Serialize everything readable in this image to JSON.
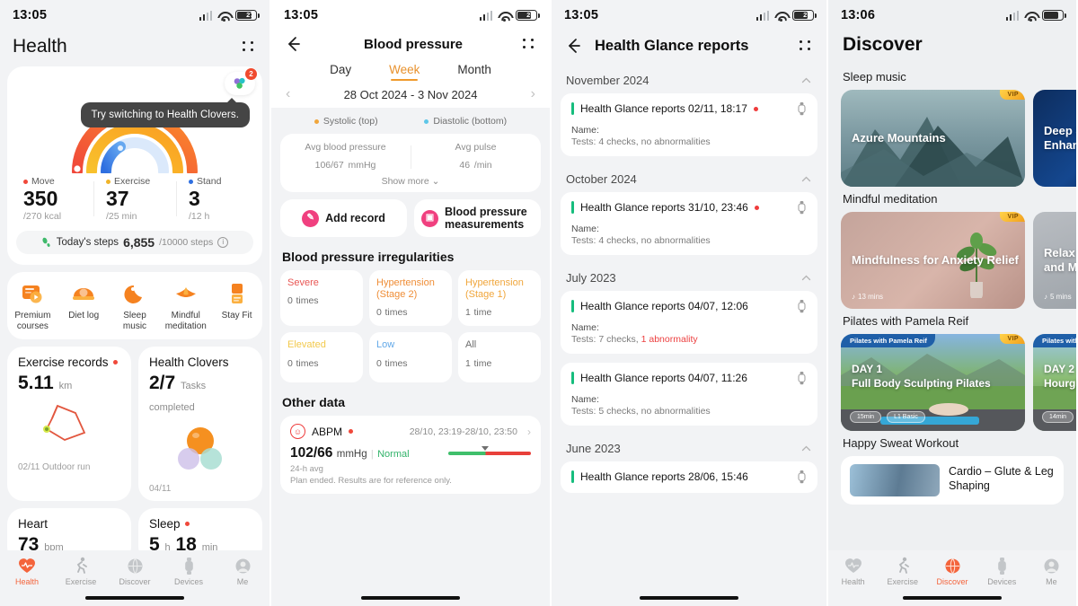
{
  "panel1": {
    "status": {
      "time": "13:05",
      "battery": "27"
    },
    "header": {
      "title": "Health",
      "menu_icon": "kebab-menu-icon"
    },
    "clover_badge": "2",
    "tooltip": "Try switching to Health Clovers.",
    "rings": [
      {
        "label": "Move",
        "value": "350",
        "sub": "/270 kcal",
        "color": "#f0483a"
      },
      {
        "label": "Exercise",
        "value": "37",
        "sub": "/25 min",
        "color": "#f0b429"
      },
      {
        "label": "Stand",
        "value": "3",
        "sub": "/12 h",
        "color": "#2f6fe0"
      }
    ],
    "steps": {
      "label": "Today's steps",
      "value": "6,855",
      "goal": "/10000 steps",
      "info": "i"
    },
    "quick_actions": [
      {
        "label": "Premium courses",
        "icon": "premium-courses-icon"
      },
      {
        "label": "Diet log",
        "icon": "diet-log-icon"
      },
      {
        "label": "Sleep music",
        "icon": "sleep-music-icon"
      },
      {
        "label": "Mindful meditation",
        "icon": "mindful-meditation-icon"
      },
      {
        "label": "Stay Fit",
        "icon": "stay-fit-icon"
      }
    ],
    "exercise_card": {
      "title": "Exercise records",
      "value": "5.11",
      "unit": "km",
      "footer": "02/11 Outdoor run"
    },
    "clovers_card": {
      "title": "Health Clovers",
      "value": "2/7",
      "unit": "Tasks completed",
      "footer": "04/11"
    },
    "heart_card": {
      "title": "Heart",
      "value": "73",
      "unit": "bpm"
    },
    "sleep_card": {
      "title": "Sleep",
      "hours": "5",
      "h_unit": "h",
      "minutes": "18",
      "m_unit": "min"
    },
    "tabs": [
      {
        "label": "Health",
        "icon": "heart-icon",
        "active": true
      },
      {
        "label": "Exercise",
        "icon": "runner-icon",
        "active": false
      },
      {
        "label": "Discover",
        "icon": "globe-icon",
        "active": false
      },
      {
        "label": "Devices",
        "icon": "watch-icon",
        "active": false
      },
      {
        "label": "Me",
        "icon": "person-icon",
        "active": false
      }
    ]
  },
  "panel2": {
    "status": {
      "time": "13:05",
      "battery": "25"
    },
    "header": {
      "title": "Blood pressure",
      "back_icon": "back-arrow-icon",
      "menu_icon": "kebab-menu-icon"
    },
    "segments": [
      {
        "label": "Day",
        "active": false
      },
      {
        "label": "Week",
        "active": true
      },
      {
        "label": "Month",
        "active": false
      }
    ],
    "date_range": "28 Oct 2024 - 3 Nov 2024",
    "legend": [
      {
        "label": "Systolic (top)",
        "color": "#f0a63c"
      },
      {
        "label": "Diastolic (bottom)",
        "color": "#5ec6e8"
      }
    ],
    "avg": {
      "bp_label": "Avg blood pressure",
      "bp_value": "106/67",
      "bp_unit": "mmHg",
      "pulse_label": "Avg pulse",
      "pulse_value": "46",
      "pulse_unit": "/min",
      "show_more": "Show more"
    },
    "actions": [
      {
        "label": "Add record",
        "icon": "add-record-icon"
      },
      {
        "label": "Blood pressure measurements",
        "icon": "bp-measure-icon"
      }
    ],
    "irregularities_title": "Blood pressure irregularities",
    "irregularities": [
      {
        "label": "Severe",
        "count": "0",
        "unit": "times",
        "color": "#e85654"
      },
      {
        "label": "Hypertension (Stage 2)",
        "count": "0",
        "unit": "times",
        "color": "#ef8d36"
      },
      {
        "label": "Hypertension (Stage 1)",
        "count": "1",
        "unit": "time",
        "color": "#f0a63c"
      },
      {
        "label": "Elevated",
        "count": "0",
        "unit": "times",
        "color": "#f2c94c"
      },
      {
        "label": "Low",
        "count": "0",
        "unit": "times",
        "color": "#62a8e8"
      },
      {
        "label": "All",
        "count": "1",
        "unit": "time",
        "color": "#6d6d6d"
      }
    ],
    "other_title": "Other data",
    "abpm": {
      "name": "ABPM",
      "date": "28/10, 23:19-28/10, 23:50",
      "value": "102/66",
      "unit": "mmHg",
      "separator": "|",
      "status": "Normal",
      "sub": "24-h avg",
      "note": "Plan ended. Results are for reference only."
    }
  },
  "panel3": {
    "status": {
      "time": "13:05",
      "battery": "25"
    },
    "header": {
      "title": "Health Glance reports",
      "back_icon": "back-arrow-icon",
      "menu_icon": "kebab-menu-icon"
    },
    "groups": [
      {
        "month": "November 2024",
        "reports": [
          {
            "title": "Health Glance reports 02/11, 18:17",
            "unread": true,
            "name_label": "Name:",
            "tests": "Tests: 4 checks, no abnormalities",
            "abnormal": ""
          }
        ]
      },
      {
        "month": "October 2024",
        "reports": [
          {
            "title": "Health Glance reports 31/10, 23:46",
            "unread": true,
            "name_label": "Name:",
            "tests": "Tests: 4 checks, no abnormalities",
            "abnormal": ""
          }
        ]
      },
      {
        "month": "July 2023",
        "reports": [
          {
            "title": "Health Glance reports 04/07, 12:06",
            "unread": false,
            "name_label": "Name:",
            "tests": "Tests: 7 checks, ",
            "abnormal": "1 abnormality"
          },
          {
            "title": "Health Glance reports 04/07, 11:26",
            "unread": false,
            "name_label": "Name:",
            "tests": "Tests: 5 checks, no abnormalities",
            "abnormal": ""
          }
        ]
      },
      {
        "month": "June 2023",
        "reports": [
          {
            "title": "Health Glance reports 28/06, 15:46",
            "unread": false,
            "name_label": "",
            "tests": "",
            "abnormal": ""
          }
        ]
      }
    ]
  },
  "panel4": {
    "status": {
      "time": "13:06",
      "battery": ""
    },
    "header": {
      "title": "Discover"
    },
    "sections": [
      {
        "title": "Sleep music",
        "cards": [
          {
            "title": "Azure Mountains",
            "vip": "VIP",
            "duration": ""
          },
          {
            "title": "Deep Sleep Enhancement",
            "vip": "",
            "duration": ""
          }
        ]
      },
      {
        "title": "Mindful meditation",
        "cards": [
          {
            "title": "Mindfulness for Anxiety Relief",
            "vip": "VIP",
            "duration": "13 mins"
          },
          {
            "title": "Relax Your Body and Mind",
            "vip": "",
            "duration": "5 mins"
          }
        ]
      },
      {
        "title": "Pilates with Pamela Reif",
        "cards": [
          {
            "badge": "Pilates with Pamela Reif",
            "day": "DAY 1",
            "title": "Full Body Sculpting Pilates",
            "vip": "VIP",
            "chips": [
              "15min",
              "L1 Basic"
            ]
          },
          {
            "badge": "Pilates with Pamela Reif",
            "day": "DAY 2",
            "title": "Hourglass Figure",
            "vip": "",
            "chips": [
              "14min"
            ]
          }
        ]
      },
      {
        "title": "Happy Sweat Workout",
        "list": [
          {
            "title": "Cardio – Glute & Leg Shaping"
          }
        ]
      }
    ],
    "tabs": [
      {
        "label": "Health",
        "icon": "heart-icon",
        "active": false
      },
      {
        "label": "Exercise",
        "icon": "runner-icon",
        "active": false
      },
      {
        "label": "Discover",
        "icon": "globe-icon",
        "active": true
      },
      {
        "label": "Devices",
        "icon": "watch-icon",
        "active": false
      },
      {
        "label": "Me",
        "icon": "person-icon",
        "active": false
      }
    ]
  }
}
